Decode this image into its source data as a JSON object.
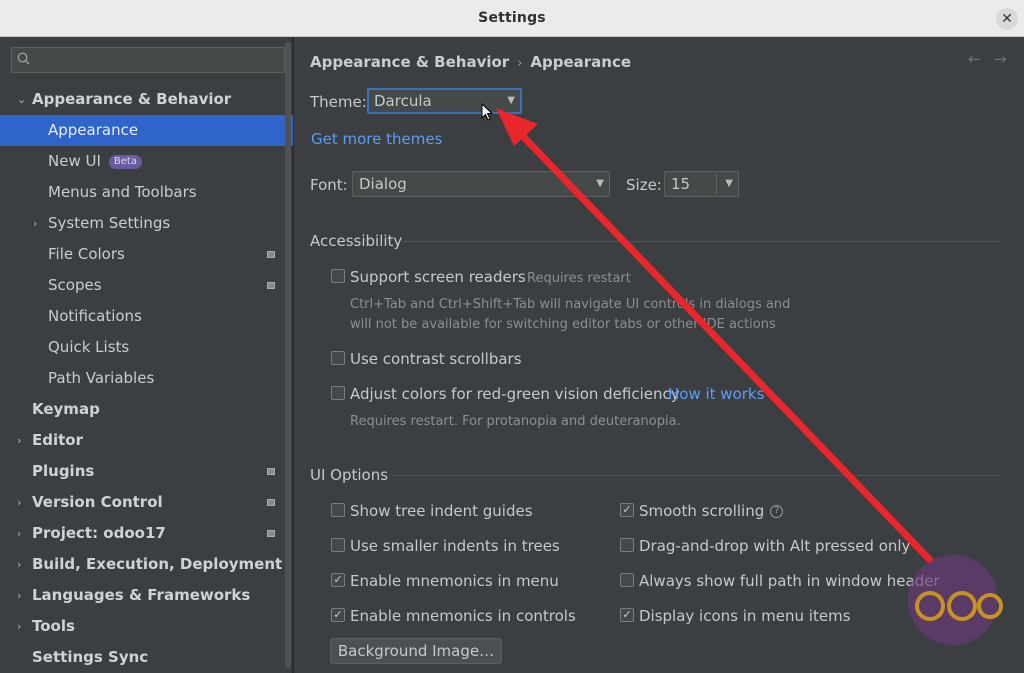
{
  "window": {
    "title": "Settings",
    "close": "✕"
  },
  "sidebar": {
    "search_placeholder": "",
    "items": [
      {
        "label": "Appearance & Behavior",
        "chev": "⌄",
        "level": 0,
        "bold": true,
        "selected": false,
        "modified": false
      },
      {
        "label": "Appearance",
        "chev": "",
        "level": 1,
        "bold": false,
        "selected": true,
        "modified": false
      },
      {
        "label": "New UI",
        "chev": "",
        "level": 1,
        "bold": false,
        "selected": false,
        "modified": false,
        "badge": "Beta"
      },
      {
        "label": "Menus and Toolbars",
        "chev": "",
        "level": 1,
        "bold": false,
        "selected": false,
        "modified": false
      },
      {
        "label": "System Settings",
        "chev": "›",
        "level": 1,
        "bold": false,
        "selected": false,
        "modified": false
      },
      {
        "label": "File Colors",
        "chev": "",
        "level": 1,
        "bold": false,
        "selected": false,
        "modified": true
      },
      {
        "label": "Scopes",
        "chev": "",
        "level": 1,
        "bold": false,
        "selected": false,
        "modified": true
      },
      {
        "label": "Notifications",
        "chev": "",
        "level": 1,
        "bold": false,
        "selected": false,
        "modified": false
      },
      {
        "label": "Quick Lists",
        "chev": "",
        "level": 1,
        "bold": false,
        "selected": false,
        "modified": false
      },
      {
        "label": "Path Variables",
        "chev": "",
        "level": 1,
        "bold": false,
        "selected": false,
        "modified": false
      },
      {
        "label": "Keymap",
        "chev": "",
        "level": 0,
        "bold": true,
        "selected": false,
        "modified": false
      },
      {
        "label": "Editor",
        "chev": "›",
        "level": 0,
        "bold": true,
        "selected": false,
        "modified": false
      },
      {
        "label": "Plugins",
        "chev": "",
        "level": 0,
        "bold": true,
        "selected": false,
        "modified": true
      },
      {
        "label": "Version Control",
        "chev": "›",
        "level": 0,
        "bold": true,
        "selected": false,
        "modified": true
      },
      {
        "label": "Project: odoo17",
        "chev": "›",
        "level": 0,
        "bold": true,
        "selected": false,
        "modified": true
      },
      {
        "label": "Build, Execution, Deployment",
        "chev": "›",
        "level": 0,
        "bold": true,
        "selected": false,
        "modified": false
      },
      {
        "label": "Languages & Frameworks",
        "chev": "›",
        "level": 0,
        "bold": true,
        "selected": false,
        "modified": false
      },
      {
        "label": "Tools",
        "chev": "›",
        "level": 0,
        "bold": true,
        "selected": false,
        "modified": false
      },
      {
        "label": "Settings Sync",
        "chev": "",
        "level": 0,
        "bold": true,
        "selected": false,
        "modified": false
      }
    ]
  },
  "breadcrumb": {
    "parent": "Appearance & Behavior",
    "sep": "›",
    "current": "Appearance"
  },
  "nav": {
    "back": "←",
    "forward": "→"
  },
  "theme": {
    "label": "Theme:",
    "value": "Darcula",
    "more_link": "Get more themes"
  },
  "font": {
    "label": "Font:",
    "value": "Dialog",
    "size_label": "Size:",
    "size_value": "15"
  },
  "accessibility": {
    "title": "Accessibility",
    "screen_readers": {
      "label": "Support screen readers",
      "note": "Requires restart",
      "checked": false
    },
    "screen_readers_hint_1": "Ctrl+Tab and Ctrl+Shift+Tab will navigate UI controls in dialogs and",
    "screen_readers_hint_2": "will not be available for switching editor tabs or other IDE actions",
    "contrast": {
      "label": "Use contrast scrollbars",
      "checked": false
    },
    "redgreen": {
      "label": "Adjust colors for red-green vision deficiency",
      "link": "How it works",
      "checked": false
    },
    "redgreen_hint": "Requires restart. For protanopia and deuteranopia."
  },
  "ui_options": {
    "title": "UI Options",
    "left": [
      {
        "label": "Show tree indent guides",
        "checked": false
      },
      {
        "label": "Use smaller indents in trees",
        "checked": false
      },
      {
        "label": "Enable mnemonics in menu",
        "checked": true
      },
      {
        "label": "Enable mnemonics in controls",
        "checked": true
      }
    ],
    "right": [
      {
        "label": "Smooth scrolling",
        "checked": true,
        "help": "?"
      },
      {
        "label": "Drag-and-drop with Alt pressed only",
        "checked": false
      },
      {
        "label": "Always show full path in window header",
        "checked": false
      },
      {
        "label": "Display icons in menu items",
        "checked": true
      }
    ],
    "background_button": "Background Image…"
  },
  "colors": {
    "selection": "#2f65ca",
    "link": "#589df6",
    "annotation": "#e8262b"
  }
}
